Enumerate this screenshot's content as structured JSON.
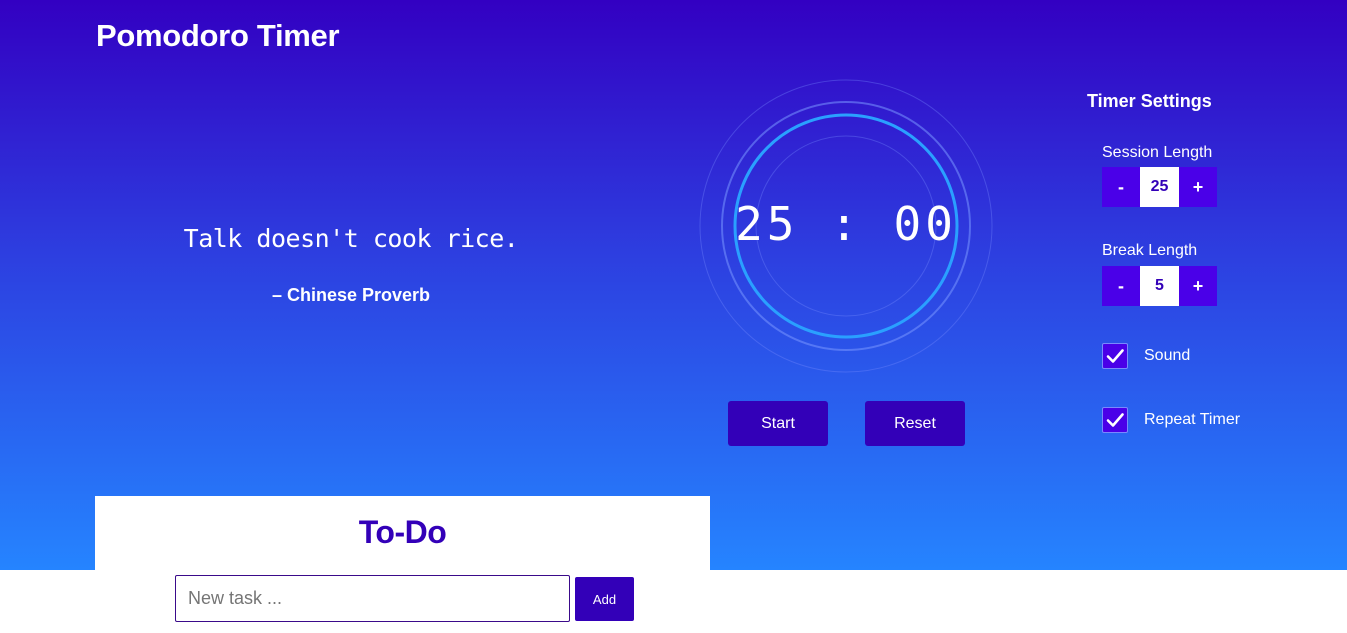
{
  "header": {
    "title": "Pomodoro Timer"
  },
  "quote": {
    "text": "Talk doesn't cook rice.",
    "author": "– Chinese Proverb"
  },
  "timer": {
    "display": "25 : 00",
    "start_label": "Start",
    "reset_label": "Reset"
  },
  "settings": {
    "title": "Timer Settings",
    "session": {
      "label": "Session Length",
      "value": "25",
      "decrement": "-",
      "increment": "+"
    },
    "break": {
      "label": "Break Length",
      "value": "5",
      "decrement": "-",
      "increment": "+"
    },
    "sound": {
      "label": "Sound",
      "checked": true
    },
    "repeat": {
      "label": "Repeat Timer",
      "checked": true
    }
  },
  "todo": {
    "title": "To-Do",
    "input_placeholder": "New task ...",
    "add_label": "Add"
  },
  "colors": {
    "gradient_top": "#3300c2",
    "gradient_bottom": "#2584ff",
    "button": "#3300b8",
    "stepper_button": "#4a00e8",
    "ring": "#2aa0ff"
  }
}
